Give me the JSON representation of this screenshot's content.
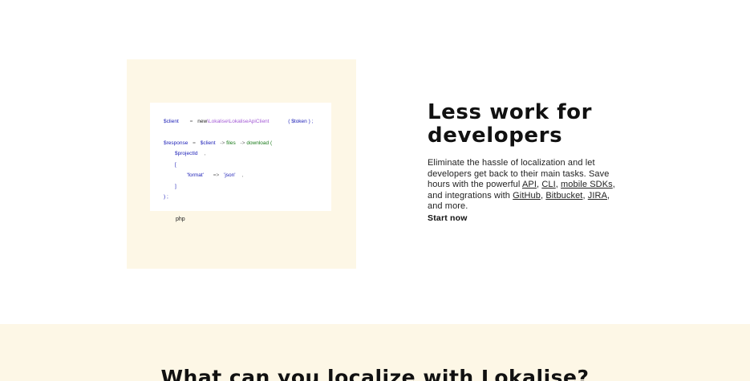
{
  "code_sample": {
    "line1": {
      "var": "$client",
      "op": "=",
      "new": "new",
      "class": "\\Lokalise\\LokaliseApiClient",
      "arg": "( $token ) ;"
    },
    "line2": {
      "var": "$response",
      "op": "=",
      "obj": "$client",
      "arrow1": "->",
      "files": "files",
      "arrow2": "->",
      "method": "download ("
    },
    "line3": {
      "var": "$projectId",
      "punct": ","
    },
    "line4": {
      "text": "["
    },
    "line5": {
      "key": "'format'",
      "op": "=>",
      "value": "'json'",
      "punct": ","
    },
    "line6": {
      "text": "]"
    },
    "line7": {
      "text": ") ;"
    },
    "language": "php"
  },
  "hero": {
    "title_line1": "Less work for",
    "title_line2": "developers",
    "desc_part1": "Eliminate the hassle of localization and let developers get back to their main tasks. Save hours with the powerful ",
    "link_api": "API",
    "sep1": ", ",
    "link_cli": "CLI",
    "sep2": ", ",
    "link_sdks": "mobile SDKs",
    "desc_part2": ", and integrations with ",
    "link_github": "GitHub",
    "sep3": ", ",
    "link_bitbucket": "Bitbucket",
    "sep4": ", ",
    "link_jira": "JIRA",
    "desc_part3": ", and more.",
    "cta": "Start now"
  },
  "next_section": {
    "heading": "What can you localize with Lokalise?"
  }
}
